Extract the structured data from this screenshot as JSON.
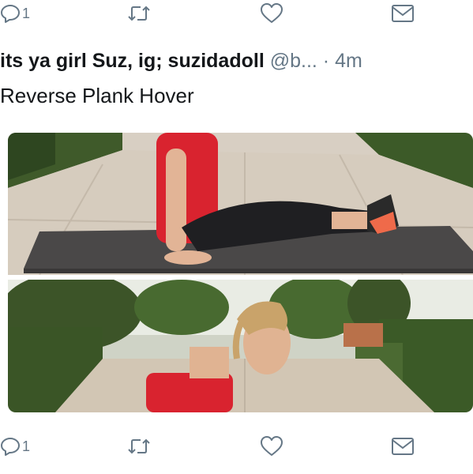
{
  "top_actions": {
    "reply_count": "1"
  },
  "tweet": {
    "display_name": "its ya girl Suz,  ig; suzidadoll",
    "handle": "@b...",
    "separator": "·",
    "time": "4m",
    "text": "Reverse Plank Hover"
  },
  "media": {
    "photos": [
      {
        "subject": "woman seated on exercise mat in reverse plank start position, red top, black leggings, pink sneakers"
      },
      {
        "subject": "woman with blonde ponytail bending forward, red top, garden walkway background"
      }
    ]
  },
  "bottom_actions": {
    "reply_count": "1"
  },
  "colors": {
    "icon_gray": "#657786",
    "text_dark": "#14171a",
    "top_red": "#d9232f"
  },
  "icons": [
    "reply-icon",
    "retweet-icon",
    "like-icon",
    "dm-icon"
  ]
}
